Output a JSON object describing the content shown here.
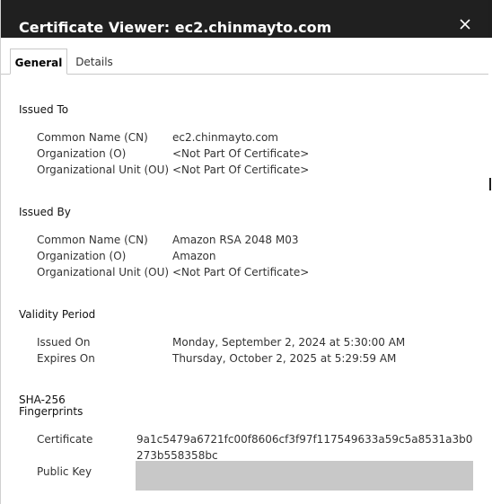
{
  "dialog": {
    "title": "Certificate Viewer: ec2.chinmayto.com",
    "close_icon": "close-icon"
  },
  "tabs": [
    {
      "label": "General",
      "selected": true
    },
    {
      "label": "Details",
      "selected": false
    }
  ],
  "issued_to": {
    "heading": "Issued To",
    "rows": [
      {
        "label": "Common Name (CN)",
        "value": "ec2.chinmayto.com"
      },
      {
        "label": "Organization (O)",
        "value": "<Not Part Of Certificate>"
      },
      {
        "label": "Organizational Unit (OU)",
        "value": "<Not Part Of Certificate>"
      }
    ]
  },
  "issued_by": {
    "heading": "Issued By",
    "rows": [
      {
        "label": "Common Name (CN)",
        "value": "Amazon RSA 2048 M03"
      },
      {
        "label": "Organization (O)",
        "value": "Amazon"
      },
      {
        "label": "Organizational Unit (OU)",
        "value": "<Not Part Of Certificate>"
      }
    ]
  },
  "validity": {
    "heading": "Validity Period",
    "rows": [
      {
        "label": "Issued On",
        "value": "Monday, September 2, 2024 at 5:30:00 AM"
      },
      {
        "label": "Expires On",
        "value": "Thursday, October 2, 2025 at 5:29:59 AM"
      }
    ]
  },
  "fingerprints": {
    "heading_line1": "SHA-256",
    "heading_line2": "Fingerprints",
    "certificate_label": "Certificate",
    "certificate_value": "9a1c5479a6721fc00f8606cf3f97f117549633a59c5a8531a3b0273b558358bc",
    "public_key_label": "Public Key"
  },
  "colors": {
    "titlebar": "#202020",
    "title_text": "#ffffff",
    "body_text": "#333333",
    "redaction": "#c8c8c8"
  }
}
